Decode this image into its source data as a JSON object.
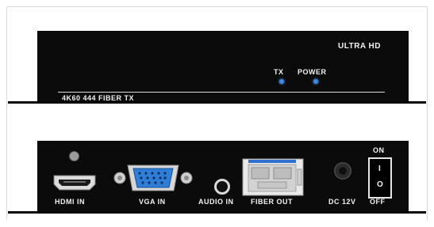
{
  "top_panel": {
    "brand": "ULTRA HD",
    "tx_label": "TX",
    "power_label": "POWER",
    "model": "4K60 444 FIBER TX",
    "led_color": "#3f8ae6"
  },
  "bottom_panel": {
    "hdmi_label": "HDMI IN",
    "vga_label": "VGA IN",
    "audio_label": "AUDIO IN",
    "fiber_label": "FIBER OUT",
    "dc_label": "DC 12V",
    "switch_on": "ON",
    "switch_off": "OFF",
    "switch_i": "I",
    "switch_o": "O",
    "vga_color": "#2f7fd8"
  }
}
